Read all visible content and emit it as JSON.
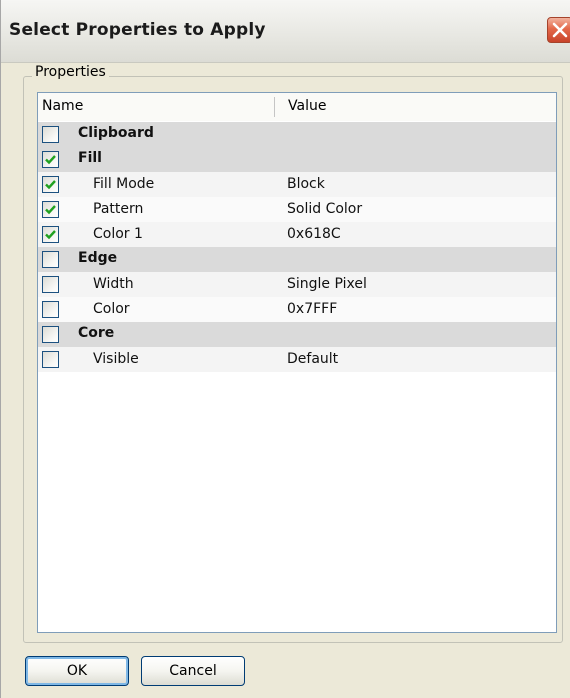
{
  "window": {
    "title": "Select Properties to Apply"
  },
  "groupbox": {
    "label": "Properties"
  },
  "grid": {
    "columns": {
      "name": "Name",
      "value": "Value"
    },
    "rows": [
      {
        "kind": "category",
        "label": "Clipboard",
        "value": "",
        "checked": false
      },
      {
        "kind": "category",
        "label": "Fill",
        "value": "",
        "checked": true
      },
      {
        "kind": "prop",
        "label": "Fill Mode",
        "value": "Block",
        "checked": true
      },
      {
        "kind": "prop",
        "label": "Pattern",
        "value": "Solid Color",
        "checked": true
      },
      {
        "kind": "prop",
        "label": "Color 1",
        "value": "0x618C",
        "checked": true
      },
      {
        "kind": "category",
        "label": "Edge",
        "value": "",
        "checked": false
      },
      {
        "kind": "prop",
        "label": "Width",
        "value": "Single Pixel",
        "checked": false
      },
      {
        "kind": "prop",
        "label": "Color",
        "value": "0x7FFF",
        "checked": false
      },
      {
        "kind": "category",
        "label": "Core",
        "value": "",
        "checked": false
      },
      {
        "kind": "prop",
        "label": "Visible",
        "value": "Default",
        "checked": false
      }
    ]
  },
  "buttons": {
    "ok": "OK",
    "cancel": "Cancel"
  },
  "icons": {
    "close": "close-icon",
    "check": "checkmark-icon"
  },
  "colors": {
    "check": "#21a121",
    "close_button": "#e3684a",
    "category_row": "#dadada"
  }
}
